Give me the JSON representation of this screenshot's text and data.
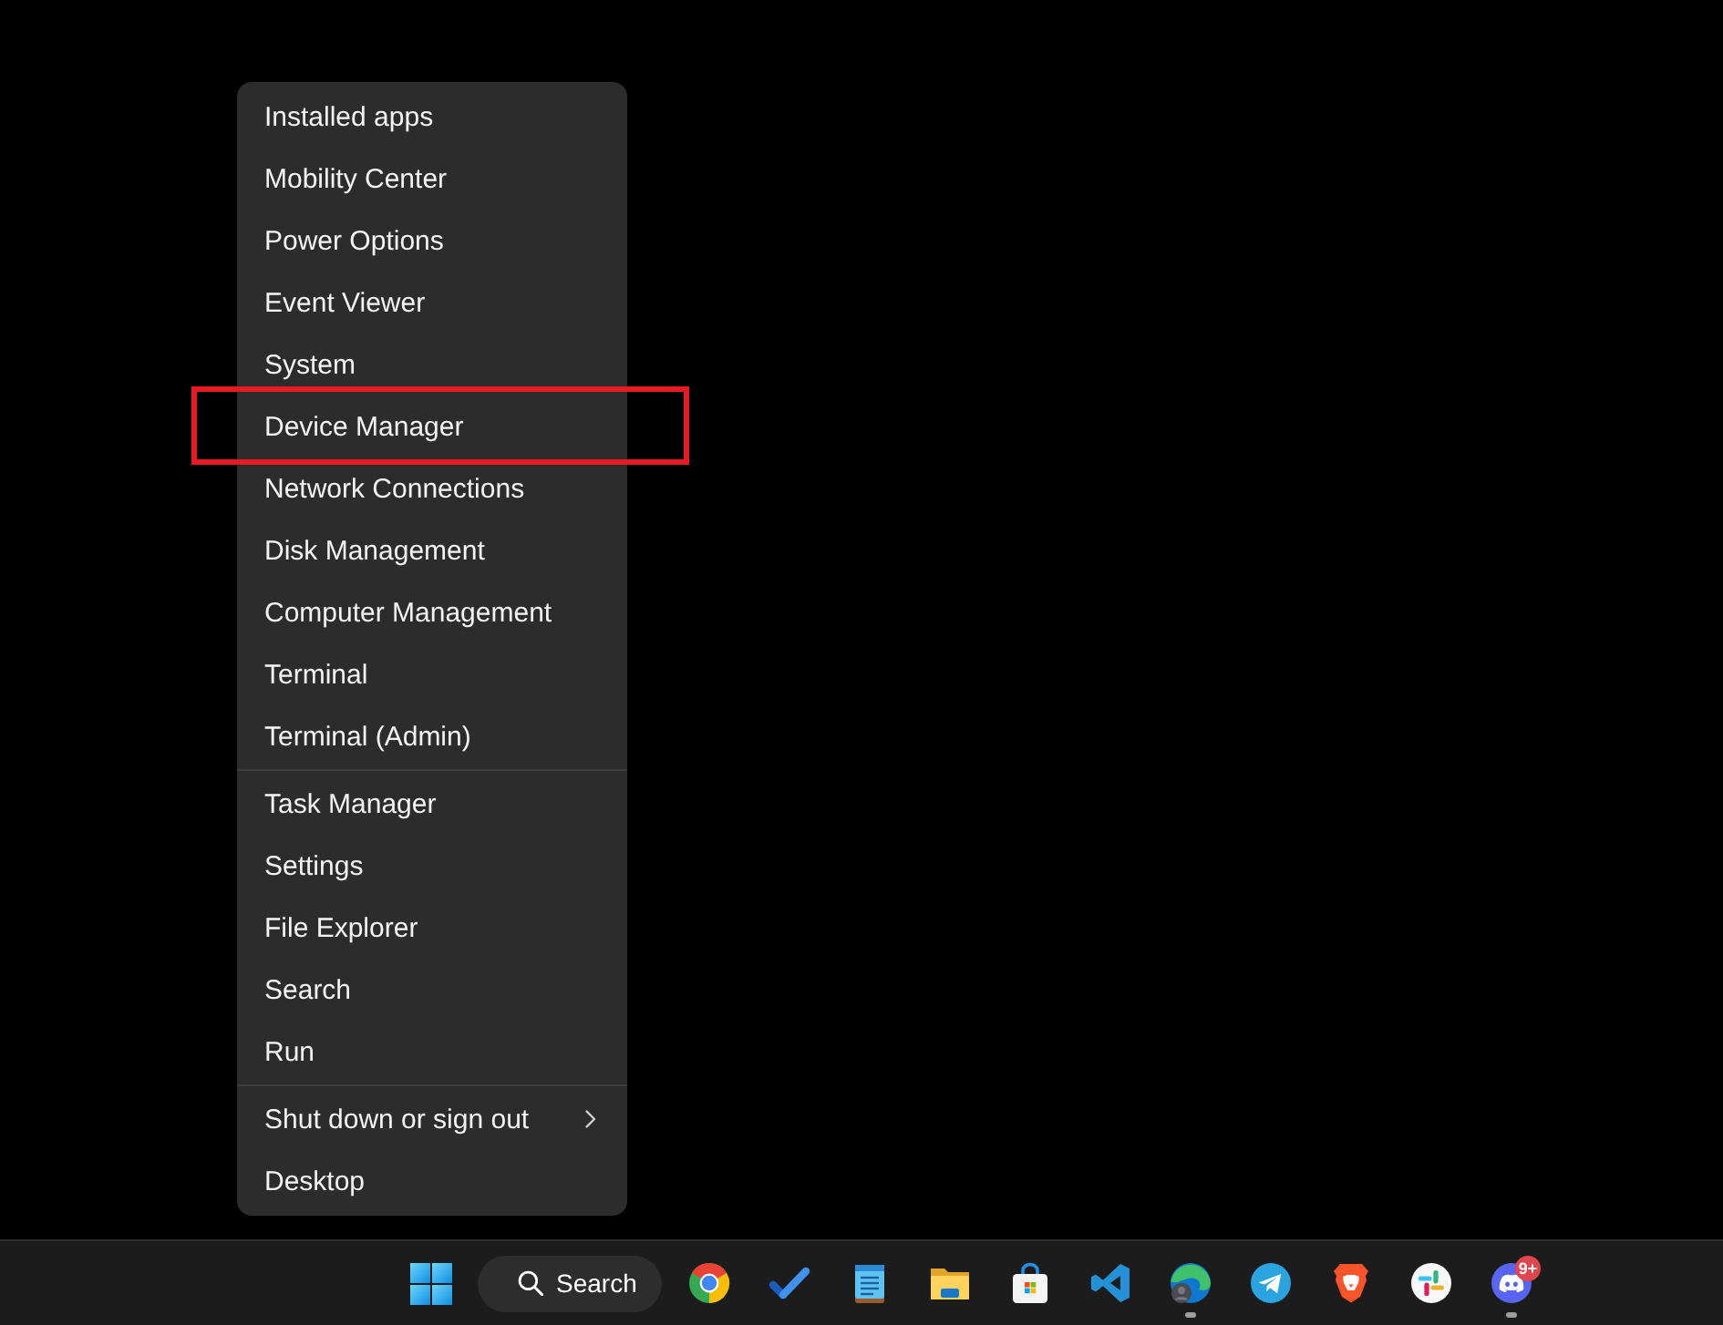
{
  "menu": {
    "groups": [
      {
        "items": [
          {
            "label": "Installed apps",
            "submenu": false,
            "outlined": false
          },
          {
            "label": "Mobility Center",
            "submenu": false,
            "outlined": false
          },
          {
            "label": "Power Options",
            "submenu": false,
            "outlined": false
          },
          {
            "label": "Event Viewer",
            "submenu": false,
            "outlined": false
          },
          {
            "label": "System",
            "submenu": false,
            "outlined": false
          },
          {
            "label": "Device Manager",
            "submenu": false,
            "outlined": true
          },
          {
            "label": "Network Connections",
            "submenu": false,
            "outlined": false
          },
          {
            "label": "Disk Management",
            "submenu": false,
            "outlined": false
          },
          {
            "label": "Computer Management",
            "submenu": false,
            "outlined": false
          },
          {
            "label": "Terminal",
            "submenu": false,
            "outlined": false
          },
          {
            "label": "Terminal (Admin)",
            "submenu": false,
            "outlined": false
          }
        ]
      },
      {
        "items": [
          {
            "label": "Task Manager",
            "submenu": false,
            "outlined": false
          },
          {
            "label": "Settings",
            "submenu": false,
            "outlined": false
          },
          {
            "label": "File Explorer",
            "submenu": false,
            "outlined": false
          },
          {
            "label": "Search",
            "submenu": false,
            "outlined": false
          },
          {
            "label": "Run",
            "submenu": false,
            "outlined": false
          }
        ]
      },
      {
        "items": [
          {
            "label": "Shut down or sign out",
            "submenu": true,
            "outlined": false
          },
          {
            "label": "Desktop",
            "submenu": false,
            "outlined": false
          }
        ]
      }
    ]
  },
  "taskbar": {
    "search": {
      "label": "Search"
    },
    "apps": [
      {
        "running": false
      },
      {
        "running": false
      },
      {
        "running": false
      },
      {
        "running": false
      },
      {
        "running": false
      },
      {
        "running": false
      },
      {
        "running": true
      },
      {
        "running": false
      },
      {
        "running": false
      },
      {
        "running": false
      },
      {
        "running": true,
        "badge": "9+"
      }
    ]
  }
}
